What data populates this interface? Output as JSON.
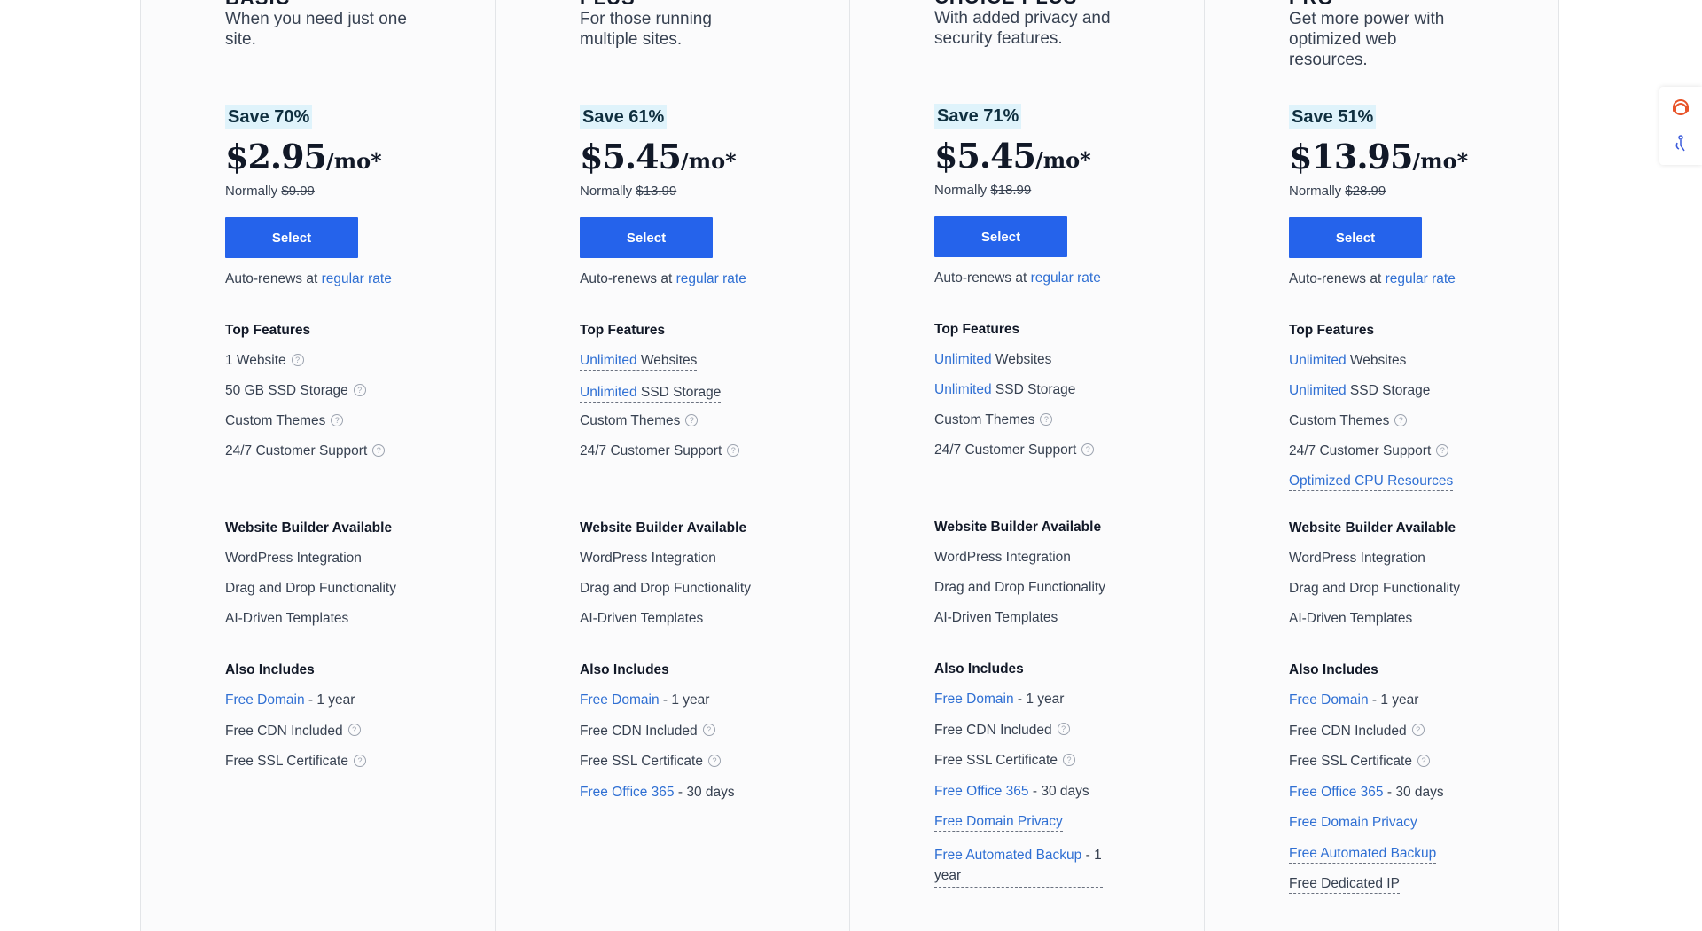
{
  "plans": [
    {
      "name": "BASIC",
      "desc": "When you need just one site.",
      "save": "Save 70%",
      "price": "$2.95",
      "per": "/mo*",
      "normally_label": "Normally",
      "normally_price": "$9.99",
      "select": "Select",
      "autorenew": "Auto-renews at",
      "regular_rate": "regular rate",
      "top_features_title": "Top Features",
      "features": [
        {
          "text": "1 Website",
          "link": "",
          "help": true
        },
        {
          "text": "50 GB SSD Storage",
          "link": "",
          "help": true
        },
        {
          "text": "Custom Themes",
          "link": "",
          "help": true
        },
        {
          "text": "24/7 Customer Support",
          "link": "",
          "help": true
        }
      ],
      "builder_title": "Website Builder Available",
      "builder": [
        "WordPress Integration",
        "Drag and Drop Functionality",
        "AI-Driven Templates"
      ],
      "also_title": "Also Includes",
      "also": [
        {
          "link": "Free Domain",
          "text": " - 1 year",
          "help": false,
          "dotted": false
        },
        {
          "link": "",
          "text": "Free CDN Included",
          "help": true,
          "dotted": false
        },
        {
          "link": "",
          "text": "Free SSL Certificate",
          "help": true,
          "dotted": false
        }
      ]
    },
    {
      "name": "PLUS",
      "desc": "For those running multiple sites.",
      "save": "Save 61%",
      "price": "$5.45",
      "per": "/mo*",
      "normally_label": "Normally",
      "normally_price": "$13.99",
      "select": "Select",
      "autorenew": "Auto-renews at",
      "regular_rate": "regular rate",
      "top_features_title": "Top Features",
      "features": [
        {
          "text": " Websites",
          "link": "Unlimited",
          "help": false,
          "dotted": true
        },
        {
          "text": " SSD Storage",
          "link": "Unlimited",
          "help": false,
          "dotted": true
        },
        {
          "text": "Custom Themes",
          "link": "",
          "help": true
        },
        {
          "text": "24/7 Customer Support",
          "link": "",
          "help": true
        }
      ],
      "builder_title": "Website Builder Available",
      "builder": [
        "WordPress Integration",
        "Drag and Drop Functionality",
        "AI-Driven Templates"
      ],
      "also_title": "Also Includes",
      "also": [
        {
          "link": "Free Domain",
          "text": " - 1 year",
          "help": false,
          "dotted": false
        },
        {
          "link": "",
          "text": "Free CDN Included",
          "help": true,
          "dotted": false
        },
        {
          "link": "",
          "text": "Free SSL Certificate",
          "help": true,
          "dotted": false
        },
        {
          "link": "Free Office 365",
          "text": " - 30 days",
          "help": false,
          "dotted": true
        }
      ]
    },
    {
      "name": "CHOICE PLUS",
      "desc": "With added privacy and security features.",
      "save": "Save 71%",
      "price": "$5.45",
      "per": "/mo*",
      "normally_label": "Normally",
      "normally_price": "$18.99",
      "select": "Select",
      "autorenew": "Auto-renews at",
      "regular_rate": "regular rate",
      "top_features_title": "Top Features",
      "features": [
        {
          "text": " Websites",
          "link": "Unlimited",
          "help": false
        },
        {
          "text": " SSD Storage",
          "link": "Unlimited",
          "help": false
        },
        {
          "text": "Custom Themes",
          "link": "",
          "help": true
        },
        {
          "text": "24/7 Customer Support",
          "link": "",
          "help": true
        }
      ],
      "builder_title": "Website Builder Available",
      "builder": [
        "WordPress Integration",
        "Drag and Drop Functionality",
        "AI-Driven Templates"
      ],
      "also_title": "Also Includes",
      "also": [
        {
          "link": "Free Domain",
          "text": " - 1 year",
          "help": false,
          "dotted": false
        },
        {
          "link": "",
          "text": "Free CDN Included",
          "help": true,
          "dotted": false
        },
        {
          "link": "",
          "text": "Free SSL Certificate",
          "help": true,
          "dotted": false
        },
        {
          "link": "Free Office 365",
          "text": " - 30 days",
          "help": false,
          "dotted": false
        },
        {
          "link": "Free Domain Privacy",
          "text": "",
          "help": false,
          "dotted": true
        },
        {
          "link": "Free Automated Backup",
          "text": " - 1 year",
          "help": false,
          "dotted": true
        }
      ]
    },
    {
      "name": "PRO",
      "desc": "Get more power with optimized web resources.",
      "save": "Save 51%",
      "price": "$13.95",
      "per": "/mo*",
      "normally_label": "Normally",
      "normally_price": "$28.99",
      "select": "Select",
      "autorenew": "Auto-renews at",
      "regular_rate": "regular rate",
      "top_features_title": "Top Features",
      "features": [
        {
          "text": " Websites",
          "link": "Unlimited",
          "help": false
        },
        {
          "text": " SSD Storage",
          "link": "Unlimited",
          "help": false
        },
        {
          "text": "Custom Themes",
          "link": "",
          "help": true
        },
        {
          "text": "24/7 Customer Support",
          "link": "",
          "help": true
        },
        {
          "text": "",
          "link": "Optimized CPU Resources",
          "help": false,
          "dotted": true
        }
      ],
      "builder_title": "Website Builder Available",
      "builder": [
        "WordPress Integration",
        "Drag and Drop Functionality",
        "AI-Driven Templates"
      ],
      "also_title": "Also Includes",
      "also": [
        {
          "link": "Free Domain",
          "text": " - 1 year",
          "help": false,
          "dotted": false
        },
        {
          "link": "",
          "text": "Free CDN Included",
          "help": true,
          "dotted": false
        },
        {
          "link": "",
          "text": "Free SSL Certificate",
          "help": true,
          "dotted": false
        },
        {
          "link": "Free Office 365",
          "text": " - 30 days",
          "help": false,
          "dotted": false
        },
        {
          "link": "Free Domain Privacy",
          "text": "",
          "help": false,
          "dotted": false
        },
        {
          "link": "Free Automated Backup",
          "text": "",
          "help": false,
          "dotted": true
        },
        {
          "link": "",
          "text": "Free Dedicated IP",
          "help": false,
          "dotted": true
        }
      ]
    }
  ],
  "help_glyph": "?",
  "icons": {
    "side_widget_top": "support-icon",
    "side_widget_bottom": "accessibility-icon"
  },
  "colors": {
    "accent": "#2563eb",
    "link": "#2f6fd3",
    "save_bg": "#dff3fb"
  }
}
